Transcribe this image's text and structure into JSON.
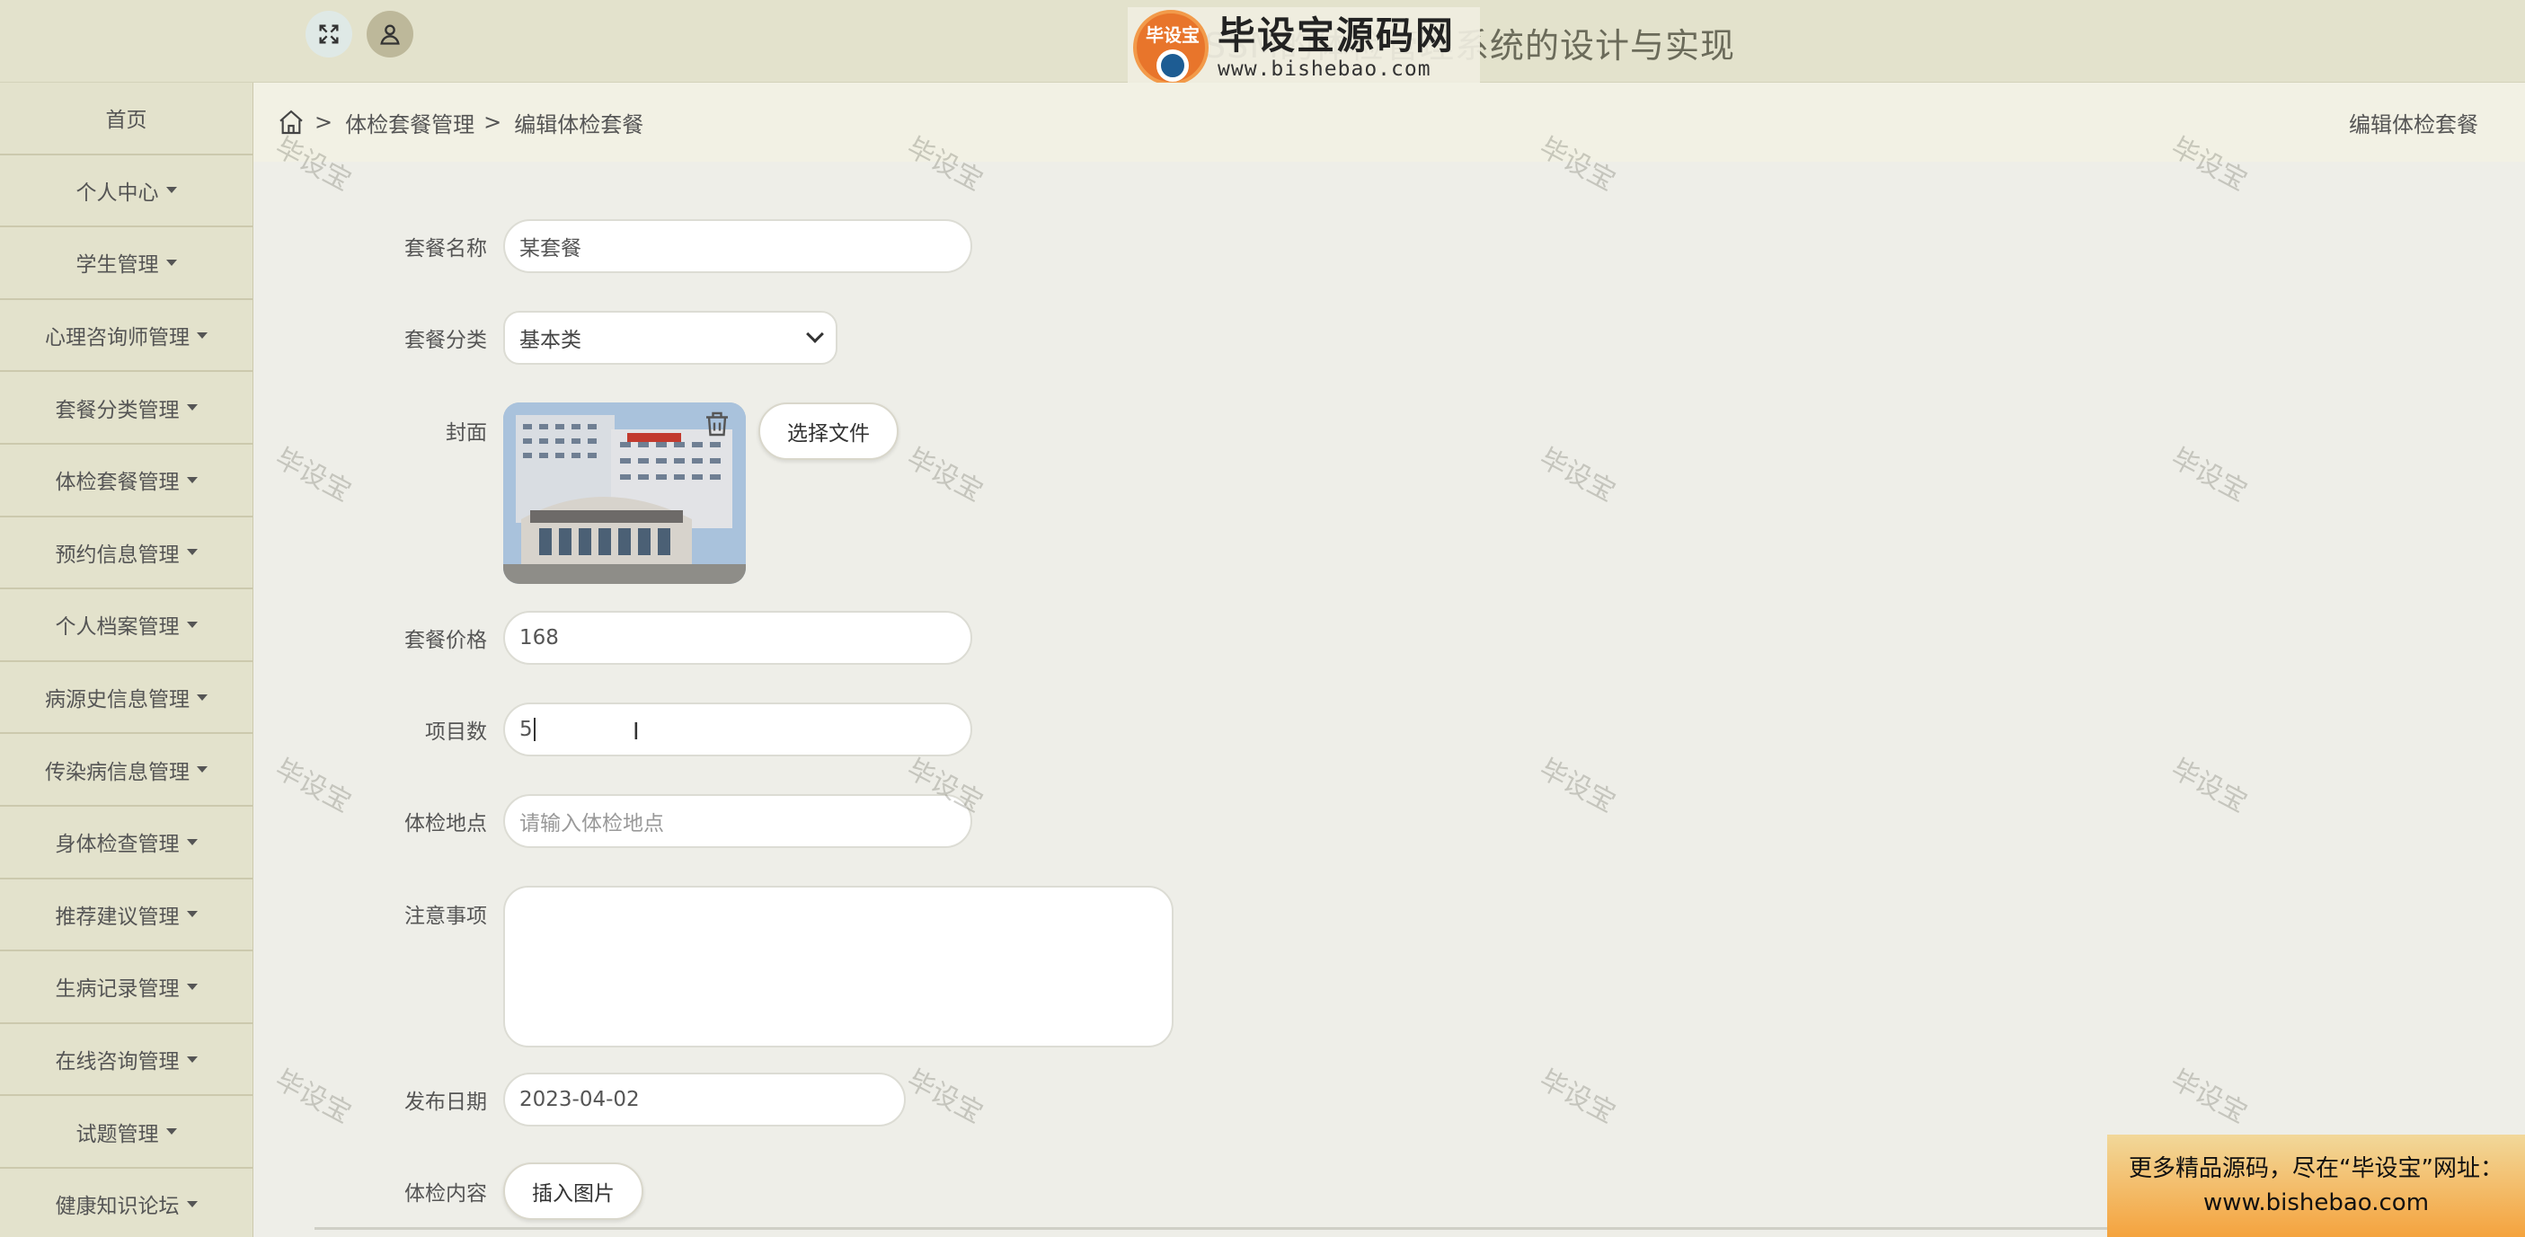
{
  "header": {
    "title_visible": "基于SSM的体检管理系统的设计与实现",
    "logo_main": "毕设宝源码网",
    "logo_sub": "www.bishebao.com",
    "logo_tag": "毕设宝"
  },
  "sidebar": {
    "items": [
      {
        "label": "首页",
        "caret": false
      },
      {
        "label": "个人中心",
        "caret": true
      },
      {
        "label": "学生管理",
        "caret": true
      },
      {
        "label": "心理咨询师管理",
        "caret": true
      },
      {
        "label": "套餐分类管理",
        "caret": true
      },
      {
        "label": "体检套餐管理",
        "caret": true
      },
      {
        "label": "预约信息管理",
        "caret": true
      },
      {
        "label": "个人档案管理",
        "caret": true
      },
      {
        "label": "病源史信息管理",
        "caret": true
      },
      {
        "label": "传染病信息管理",
        "caret": true
      },
      {
        "label": "身体检查管理",
        "caret": true
      },
      {
        "label": "推荐建议管理",
        "caret": true
      },
      {
        "label": "生病记录管理",
        "caret": true
      },
      {
        "label": "在线咨询管理",
        "caret": true
      },
      {
        "label": "试题管理",
        "caret": true
      },
      {
        "label": "健康知识论坛",
        "caret": true
      }
    ]
  },
  "breadcrumb": {
    "sep": ">",
    "level1": "体检套餐管理",
    "level2": "编辑体检套餐",
    "right": "编辑体检套餐"
  },
  "form": {
    "name_label": "套餐名称",
    "name_value": "某套餐",
    "category_label": "套餐分类",
    "category_value": "基本类",
    "cover_label": "封面",
    "choose_file": "选择文件",
    "price_label": "套餐价格",
    "price_value": "168",
    "items_label": "项目数",
    "items_value": "5",
    "location_label": "体检地点",
    "location_placeholder": "请输入体检地点",
    "notes_label": "注意事项",
    "date_label": "发布日期",
    "date_value": "2023-04-02",
    "content_label": "体检内容",
    "insert_image": "插入图片"
  },
  "watermark": "毕设宝",
  "ad": {
    "line1": "更多精品源码，尽在“毕设宝”网址：",
    "line2": "www.bishebao.com"
  }
}
